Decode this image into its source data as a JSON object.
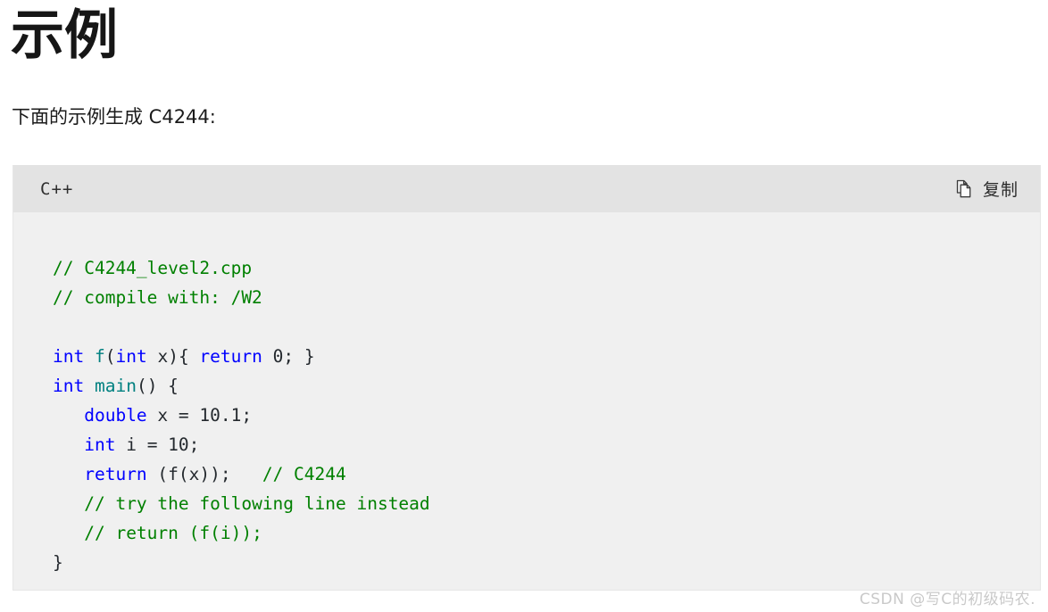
{
  "article": {
    "heading": "示例",
    "intro": "下面的示例生成 C4244:"
  },
  "code_block": {
    "language_label": "C++",
    "copy_button_label": "复制",
    "copy_icon": "copy-pages-icon",
    "header_bg": "#e3e3e3",
    "body_bg": "#f0f0f0",
    "syntax_colors": {
      "comment": "#008000",
      "keyword": "#0000ff",
      "function": "#008080",
      "plain": "#24292e"
    },
    "lines": [
      {
        "id": 1,
        "tokens": [
          {
            "t": "// C4244_level2.cpp",
            "c": "cmt"
          }
        ]
      },
      {
        "id": 2,
        "tokens": [
          {
            "t": "// compile with: /W2",
            "c": "cmt"
          }
        ]
      },
      {
        "id": 3,
        "tokens": []
      },
      {
        "id": 4,
        "tokens": [
          {
            "t": "int",
            "c": "kw"
          },
          {
            "t": " ",
            "c": "pl"
          },
          {
            "t": "f",
            "c": "fn"
          },
          {
            "t": "(",
            "c": "pl"
          },
          {
            "t": "int",
            "c": "kw"
          },
          {
            "t": " x){ ",
            "c": "pl"
          },
          {
            "t": "return",
            "c": "kw"
          },
          {
            "t": " 0; }",
            "c": "pl"
          }
        ]
      },
      {
        "id": 5,
        "tokens": [
          {
            "t": "int",
            "c": "kw"
          },
          {
            "t": " ",
            "c": "pl"
          },
          {
            "t": "main",
            "c": "fn"
          },
          {
            "t": "() {",
            "c": "pl"
          }
        ]
      },
      {
        "id": 6,
        "tokens": [
          {
            "t": "   ",
            "c": "pl"
          },
          {
            "t": "double",
            "c": "kw"
          },
          {
            "t": " x = 10.1;",
            "c": "pl"
          }
        ]
      },
      {
        "id": 7,
        "tokens": [
          {
            "t": "   ",
            "c": "pl"
          },
          {
            "t": "int",
            "c": "kw"
          },
          {
            "t": " i = 10;",
            "c": "pl"
          }
        ]
      },
      {
        "id": 8,
        "tokens": [
          {
            "t": "   ",
            "c": "pl"
          },
          {
            "t": "return",
            "c": "kw"
          },
          {
            "t": " (f(x));   ",
            "c": "pl"
          },
          {
            "t": "// C4244",
            "c": "cmt"
          }
        ]
      },
      {
        "id": 9,
        "tokens": [
          {
            "t": "   ",
            "c": "pl"
          },
          {
            "t": "// try the following line instead",
            "c": "cmt"
          }
        ]
      },
      {
        "id": 10,
        "tokens": [
          {
            "t": "   ",
            "c": "pl"
          },
          {
            "t": "// return (f(i));",
            "c": "cmt"
          }
        ]
      },
      {
        "id": 11,
        "tokens": [
          {
            "t": "}",
            "c": "pl"
          }
        ]
      }
    ]
  },
  "watermark": {
    "text": "CSDN @写C的初级码农."
  }
}
